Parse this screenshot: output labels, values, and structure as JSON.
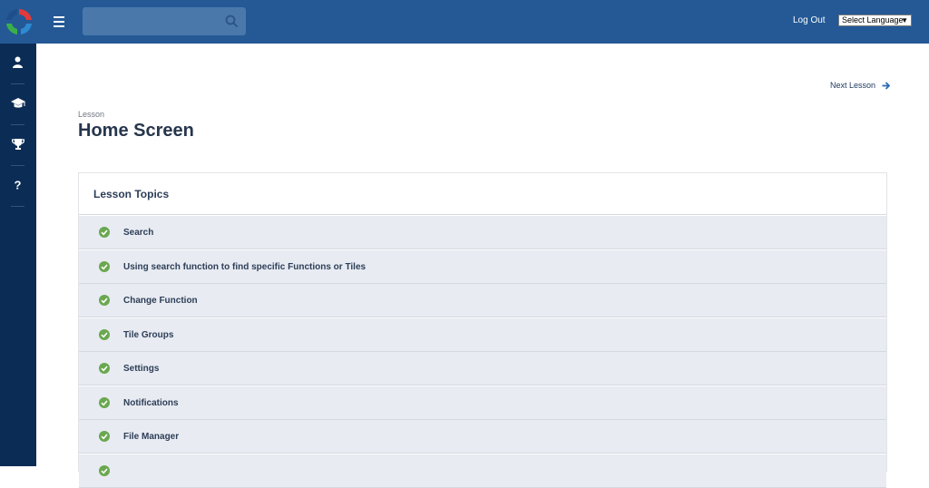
{
  "header": {
    "search_placeholder": "",
    "logout_label": "Log Out",
    "language_select": "Select Language"
  },
  "sidebar": {
    "items": [
      {
        "icon": "user-icon"
      },
      {
        "icon": "graduation-cap-icon"
      },
      {
        "icon": "trophy-icon"
      },
      {
        "icon": "question-icon",
        "glyph": "?"
      }
    ]
  },
  "page": {
    "next_lesson": "Next Lesson",
    "breadcrumb": "Lesson",
    "title": "Home Screen"
  },
  "topics": {
    "heading": "Lesson Topics",
    "items": [
      {
        "label": "Search",
        "status": "completed"
      },
      {
        "label": "Using search function to find specific Functions or Tiles",
        "status": "completed"
      },
      {
        "label": "Change Function",
        "status": "completed"
      },
      {
        "label": "Tile Groups",
        "status": "completed"
      },
      {
        "label": "Settings",
        "status": "completed"
      },
      {
        "label": "Notifications",
        "status": "completed"
      },
      {
        "label": "File Manager",
        "status": "completed"
      },
      {
        "label": "",
        "status": "completed"
      }
    ]
  },
  "colors": {
    "topbar": "#245996",
    "sidebar": "#0b2c55",
    "check": "#6aa84f",
    "topic_bg": "#e8ebf2"
  }
}
